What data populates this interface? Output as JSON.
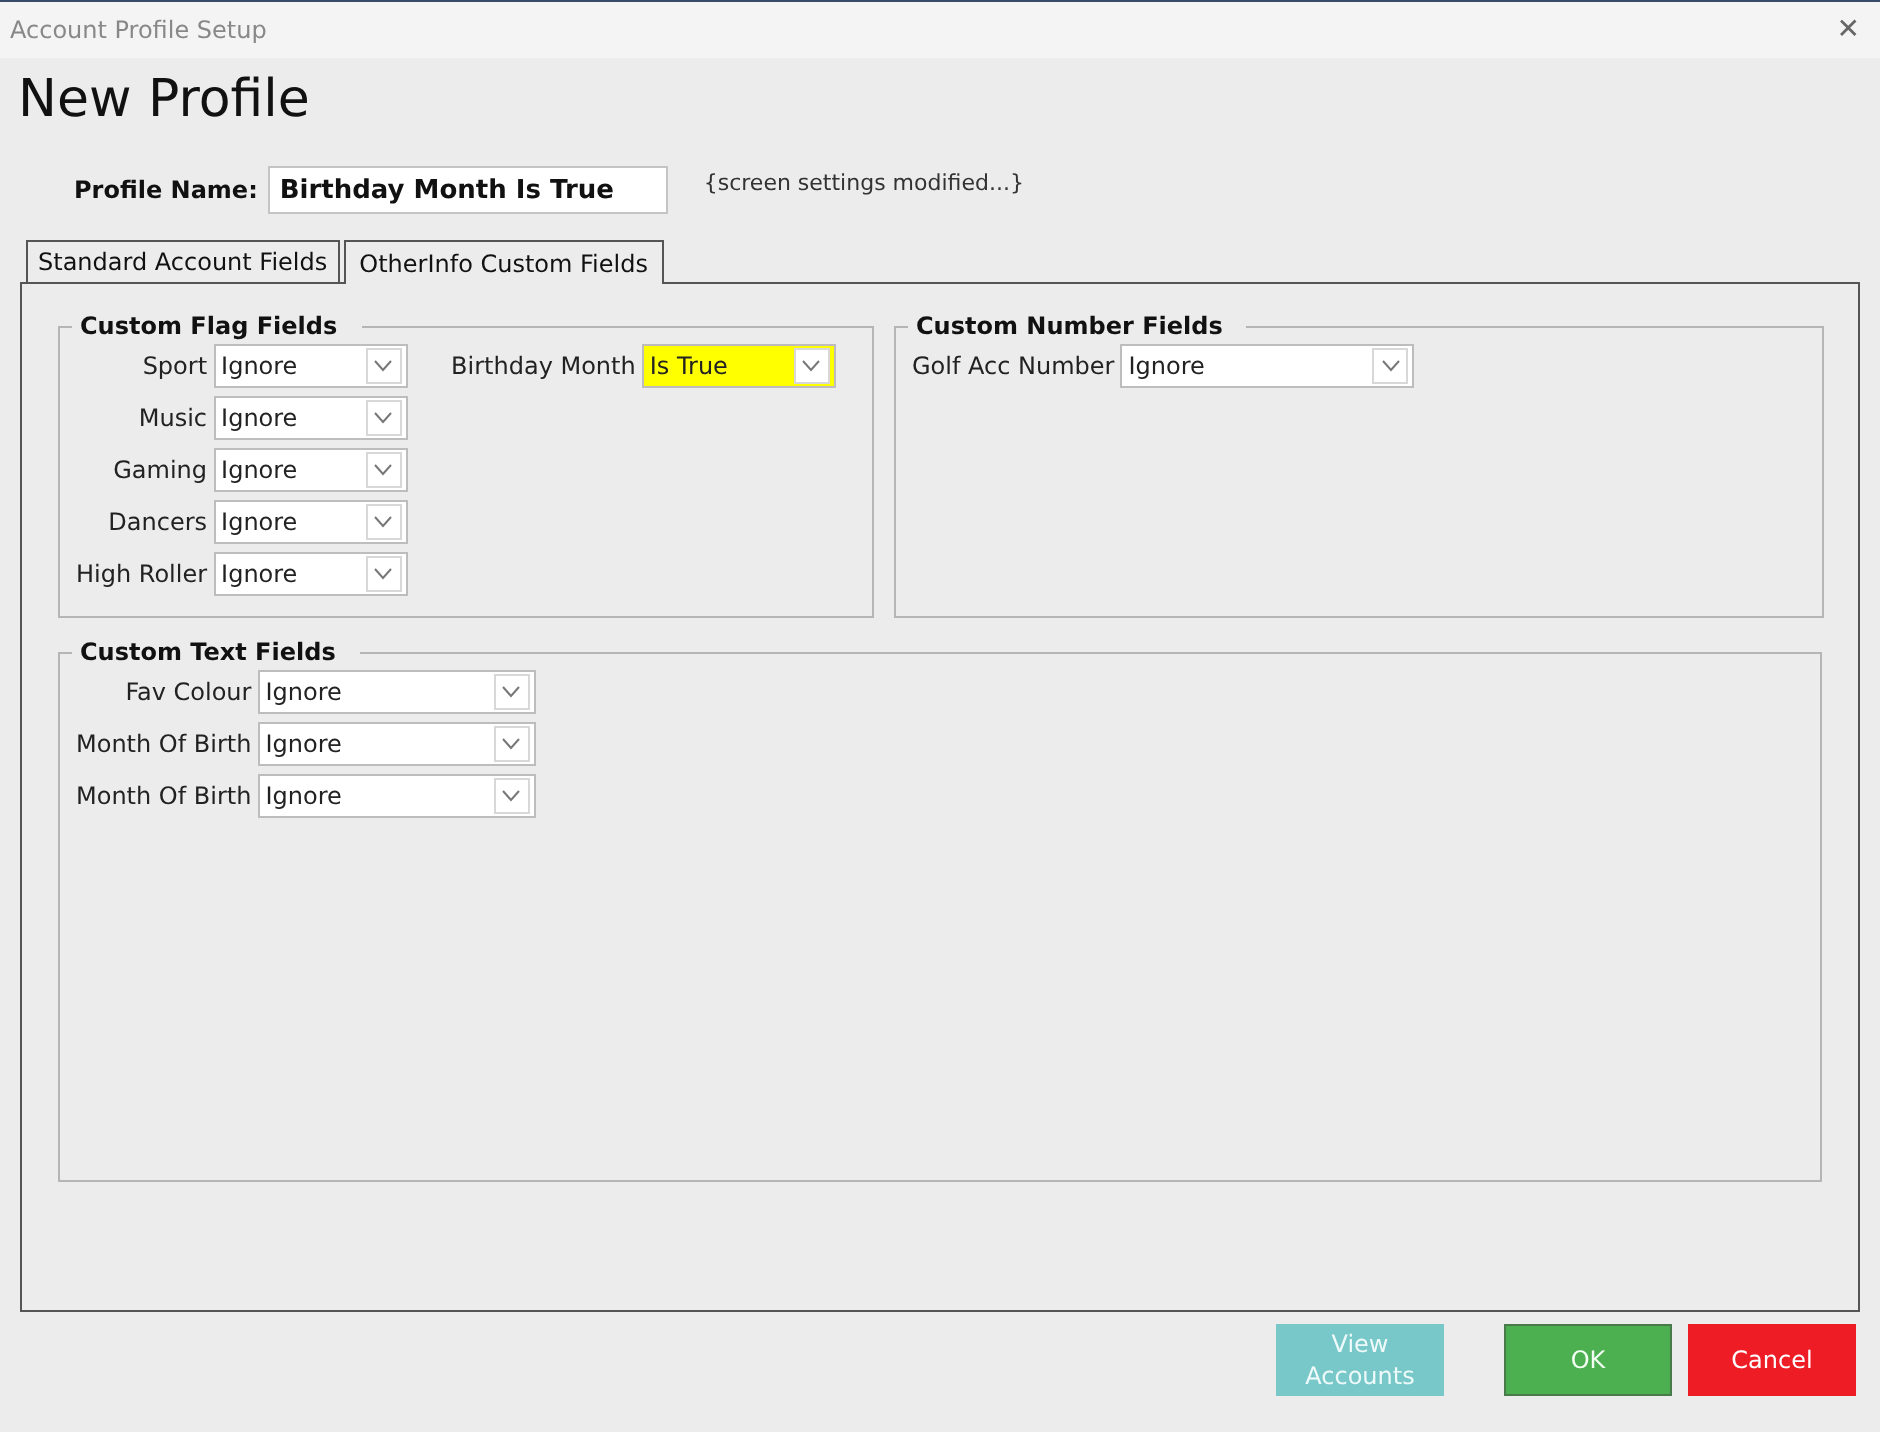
{
  "window": {
    "title": "Account Profile Setup",
    "close": "✕"
  },
  "heading": "New Profile",
  "profile_name": {
    "label": "Profile Name:",
    "value": "Birthday Month Is True",
    "note": "{screen settings modified...}"
  },
  "tabs": [
    {
      "label": "Standard Account Fields",
      "selected": false
    },
    {
      "label": "OtherInfo Custom Fields",
      "selected": true
    }
  ],
  "groups": [
    {
      "title": "Custom Flag Fields",
      "columns": [
        [
          {
            "label": "Sport",
            "value": "Ignore",
            "highlighted": false
          },
          {
            "label": "Music",
            "value": "Ignore",
            "highlighted": false
          },
          {
            "label": "Gaming",
            "value": "Ignore",
            "highlighted": false
          },
          {
            "label": "Dancers",
            "value": "Ignore",
            "highlighted": false
          },
          {
            "label": "High Roller",
            "value": "Ignore",
            "highlighted": false
          }
        ],
        [
          {
            "label": "Birthday Month",
            "value": "Is True",
            "highlighted": true
          }
        ]
      ]
    },
    {
      "title": "Custom Number Fields",
      "columns": [
        [
          {
            "label": "Golf Acc Number",
            "value": "Ignore",
            "highlighted": false
          }
        ]
      ]
    },
    {
      "title": "Custom Text Fields",
      "columns": [
        [
          {
            "label": "Fav Colour",
            "value": "Ignore",
            "highlighted": false
          },
          {
            "label": "Month Of Birth",
            "value": "Ignore",
            "highlighted": false
          },
          {
            "label": "Month Of Birth",
            "value": "Ignore",
            "highlighted": false
          }
        ]
      ]
    }
  ],
  "buttons": [
    {
      "label": "View Accounts",
      "kind": "secondary"
    },
    {
      "label": "OK",
      "kind": "primary"
    },
    {
      "label": "Cancel",
      "kind": "danger"
    }
  ]
}
